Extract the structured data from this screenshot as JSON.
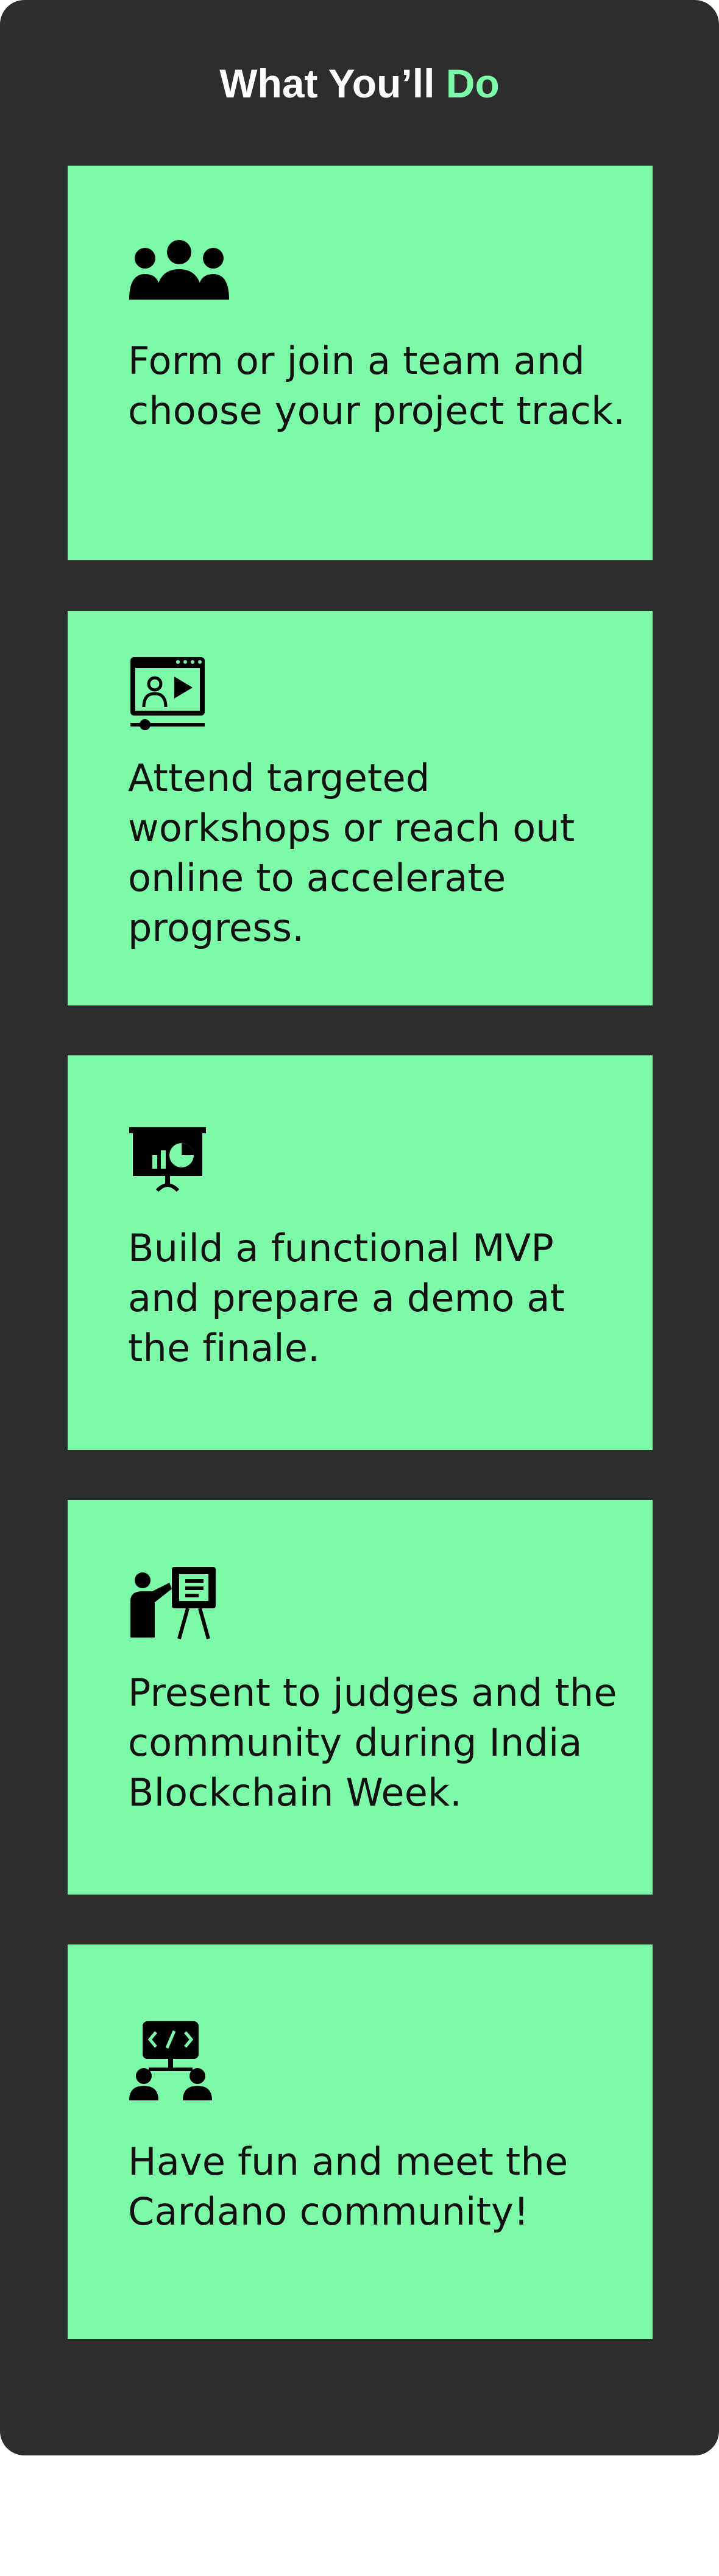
{
  "section": {
    "title_prefix": "What You’ll",
    "title_accent": "Do",
    "colors": {
      "panel_background": "#2d2d2d",
      "card_background": "#7cfca8",
      "accent": "#7cfca8",
      "text": "#111111"
    }
  },
  "steps": [
    {
      "icon": "team-icon",
      "text": "Form or join a team and choose your project track."
    },
    {
      "icon": "online-workshop-icon",
      "text": "Attend targeted workshops or reach out online to accelerate progress."
    },
    {
      "icon": "presentation-board-icon",
      "text": "Build a functional MVP and prepare a demo at the finale."
    },
    {
      "icon": "presenter-icon",
      "text": "Present to judges and the community during India Blockchain Week."
    },
    {
      "icon": "code-collaboration-icon",
      "text": "Have fun and meet the Cardano community!"
    }
  ]
}
